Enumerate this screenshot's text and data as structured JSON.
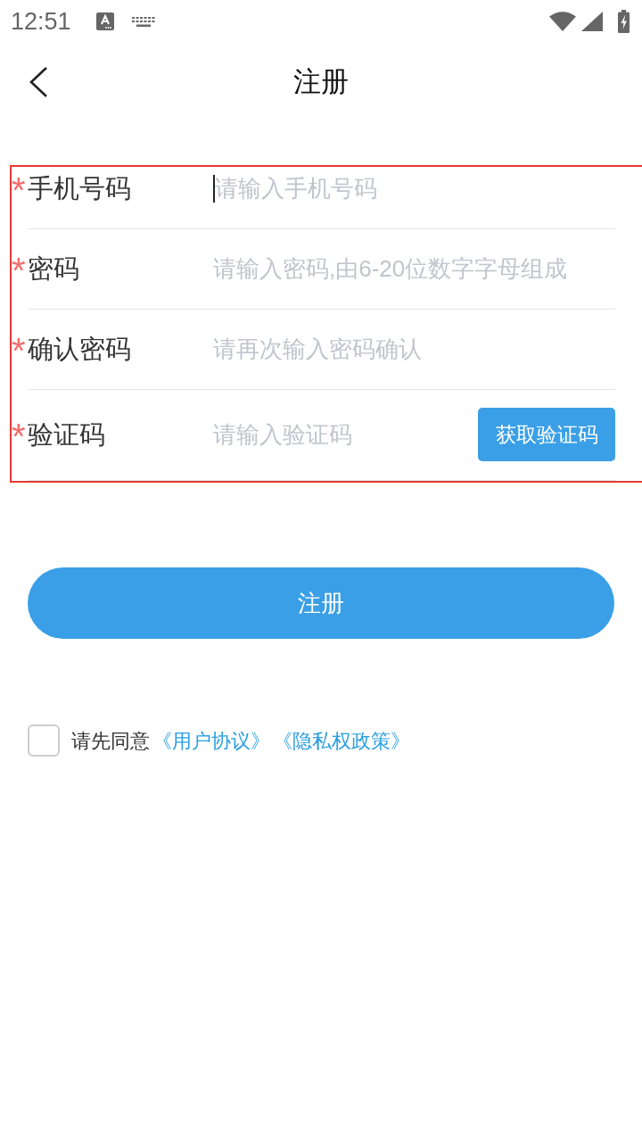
{
  "status_bar": {
    "time": "12:51"
  },
  "header": {
    "title": "注册"
  },
  "form": {
    "highlighted": true,
    "fields": [
      {
        "mark": "*",
        "label": "手机号码",
        "placeholder": "请输入手机号码",
        "focused": true
      },
      {
        "mark": "*",
        "label": "密码",
        "placeholder": "请输入密码,由6-20位数字字母组成",
        "focused": false
      },
      {
        "mark": "*",
        "label": "确认密码",
        "placeholder": "请再次输入密码确认",
        "focused": false
      },
      {
        "mark": "*",
        "label": "验证码",
        "placeholder": "请输入验证码",
        "focused": false,
        "button": "获取验证码"
      }
    ]
  },
  "submit_button": "注册",
  "agreement": {
    "checked": false,
    "text": "请先同意",
    "links": [
      "《用户协议》",
      "《隐私权政策》"
    ]
  }
}
